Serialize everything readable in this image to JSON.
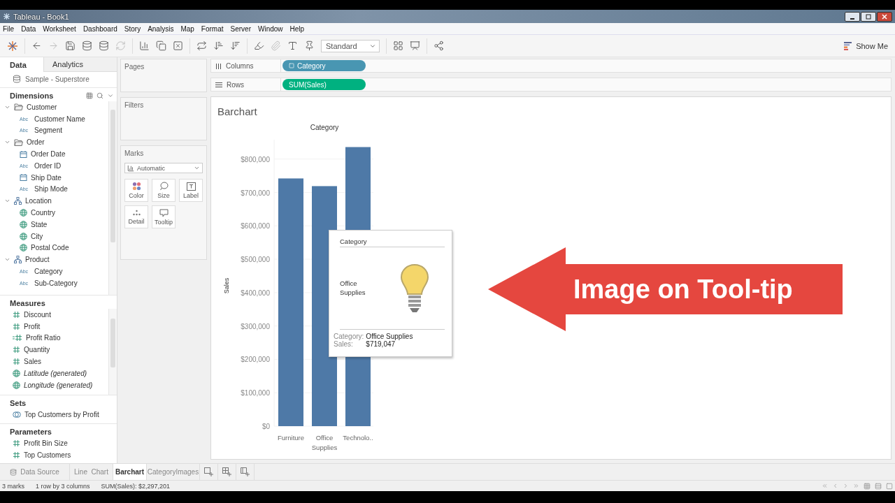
{
  "window": {
    "title": "Tableau - Book1"
  },
  "menu": [
    "File",
    "Data",
    "Worksheet",
    "Dashboard",
    "Story",
    "Analysis",
    "Map",
    "Format",
    "Server",
    "Window",
    "Help"
  ],
  "toolbar": {
    "fit": "Standard",
    "show_me": "Show Me"
  },
  "data_pane": {
    "tabs": [
      {
        "label": "Data",
        "selected": true
      },
      {
        "label": "Analytics",
        "selected": false
      }
    ],
    "source": "Sample - Superstore",
    "dimensions": {
      "title": "Dimensions",
      "items": [
        {
          "label": "Customer",
          "kind": "folder",
          "expanded": true,
          "children": [
            {
              "label": "Customer Name",
              "kind": "string",
              "badge": "Abc"
            },
            {
              "label": "Segment",
              "kind": "string",
              "badge": "Abc"
            }
          ]
        },
        {
          "label": "Order",
          "kind": "folder",
          "expanded": true,
          "children": [
            {
              "label": "Order Date",
              "kind": "date"
            },
            {
              "label": "Order ID",
              "kind": "string",
              "badge": "Abc"
            },
            {
              "label": "Ship Date",
              "kind": "date"
            },
            {
              "label": "Ship Mode",
              "kind": "string",
              "badge": "Abc"
            }
          ]
        },
        {
          "label": "Location",
          "kind": "hierarchy",
          "expanded": true,
          "children": [
            {
              "label": "Country",
              "kind": "geo"
            },
            {
              "label": "State",
              "kind": "geo"
            },
            {
              "label": "City",
              "kind": "geo"
            },
            {
              "label": "Postal Code",
              "kind": "geo"
            }
          ]
        },
        {
          "label": "Product",
          "kind": "hierarchy",
          "expanded": true,
          "children": [
            {
              "label": "Category",
              "kind": "string",
              "badge": "Abc"
            },
            {
              "label": "Sub-Category",
              "kind": "string",
              "badge": "Abc"
            }
          ]
        }
      ]
    },
    "measures": {
      "title": "Measures",
      "items": [
        {
          "label": "Discount",
          "kind": "number",
          "generated": false
        },
        {
          "label": "Profit",
          "kind": "number",
          "generated": false
        },
        {
          "label": "Profit Ratio",
          "kind": "calc",
          "generated": false
        },
        {
          "label": "Quantity",
          "kind": "number",
          "generated": false
        },
        {
          "label": "Sales",
          "kind": "number",
          "generated": false
        },
        {
          "label": "Latitude (generated)",
          "kind": "geo",
          "generated": true
        },
        {
          "label": "Longitude (generated)",
          "kind": "geo",
          "generated": true
        }
      ]
    },
    "sets": {
      "title": "Sets",
      "items": [
        "Top Customers by Profit"
      ]
    },
    "parameters": {
      "title": "Parameters",
      "items": [
        "Profit Bin Size",
        "Top Customers"
      ]
    }
  },
  "cards": {
    "pages": "Pages",
    "filters": "Filters",
    "marks": {
      "title": "Marks",
      "type": "Automatic",
      "buttons": [
        {
          "label": "Color",
          "kind": "color"
        },
        {
          "label": "Size",
          "kind": "size"
        },
        {
          "label": "Label",
          "kind": "label"
        },
        {
          "label": "Detail",
          "kind": "detail"
        },
        {
          "label": "Tooltip",
          "kind": "tooltip"
        }
      ]
    }
  },
  "shelves": [
    {
      "label": "Columns",
      "kind": "columns",
      "pill": {
        "text": "Category",
        "kind": "dimension"
      }
    },
    {
      "label": "Rows",
      "kind": "rows",
      "pill": {
        "text": "SUM(Sales)",
        "kind": "measure"
      }
    }
  ],
  "sheet": {
    "title": "Barchart",
    "chart_data": {
      "type": "bar",
      "xlabel": "Category",
      "ylabel": "Sales",
      "categories": [
        "Furniture",
        "Office Supplies",
        "Technolo.."
      ],
      "values": [
        742000,
        719000,
        836000
      ],
      "grid": true,
      "ylim": [
        0,
        858000
      ],
      "yticks": [
        {
          "value": 0,
          "label": "$0"
        },
        {
          "value": 100000,
          "label": "$100,000"
        },
        {
          "value": 200000,
          "label": "$200,000"
        },
        {
          "value": 300000,
          "label": "$300,000"
        },
        {
          "value": 400000,
          "label": "$400,000"
        },
        {
          "value": 500000,
          "label": "$500,000"
        },
        {
          "value": 600000,
          "label": "$600,000"
        },
        {
          "value": 700000,
          "label": "$700,000"
        },
        {
          "value": 800000,
          "label": "$800,000"
        }
      ]
    },
    "tooltip": {
      "header": "Category",
      "label": "Office Supplies",
      "fields": [
        {
          "name": "Category:",
          "value": "Office Supplies"
        },
        {
          "name": "Sales:",
          "value": "$719,047"
        }
      ]
    },
    "callout": "Image on Tool-tip"
  },
  "sheet_tabs": [
    {
      "label": "Data Source",
      "kind": "source",
      "selected": false
    },
    {
      "label": "Line  Chart",
      "kind": "sheet",
      "selected": false
    },
    {
      "label": "Barchart",
      "kind": "sheet",
      "selected": true
    },
    {
      "label": "CategoryImages",
      "kind": "sheet",
      "selected": false
    }
  ],
  "status_bar": [
    "3 marks",
    "1 row by 3 columns",
    "SUM(Sales): $2,297,201"
  ]
}
